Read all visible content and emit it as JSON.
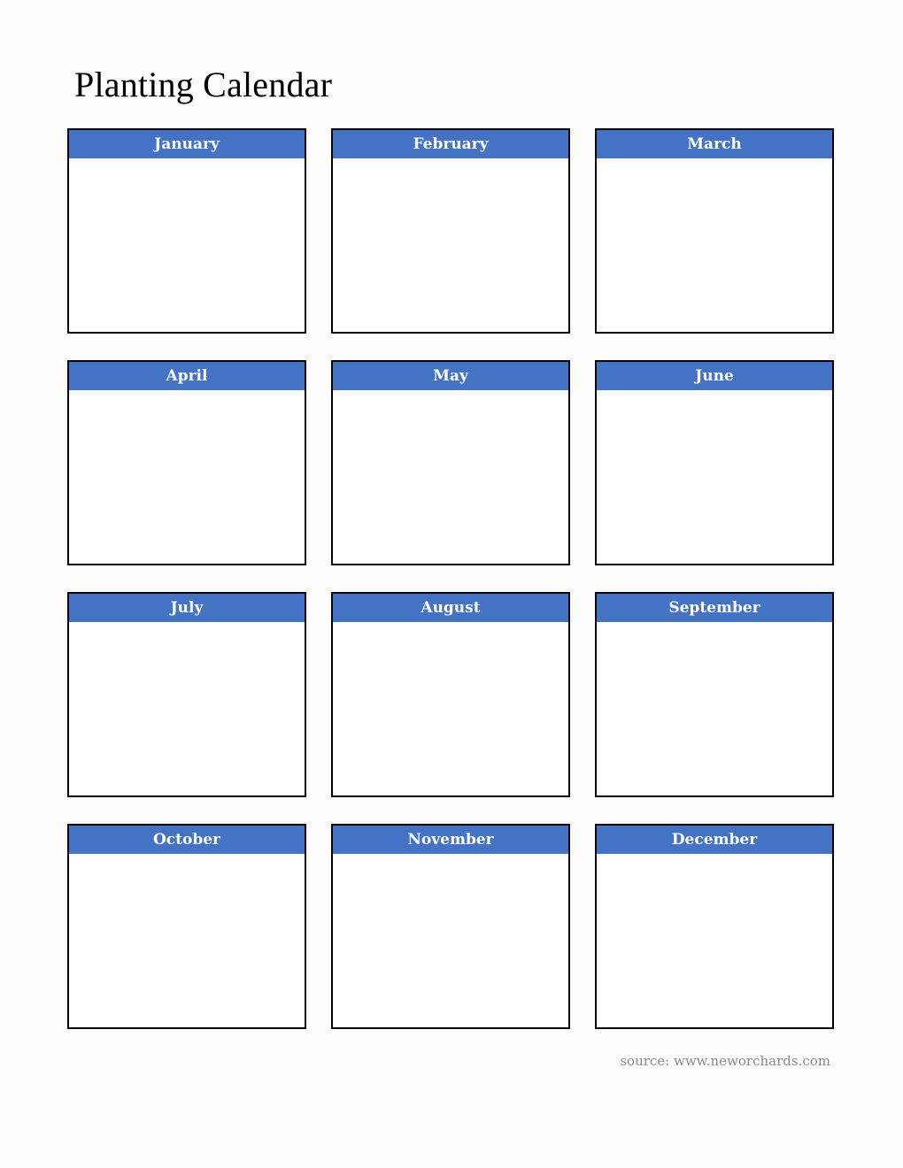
{
  "title": "Planting Calendar",
  "months": [
    {
      "label": "January"
    },
    {
      "label": "February"
    },
    {
      "label": "March"
    },
    {
      "label": "April"
    },
    {
      "label": "May"
    },
    {
      "label": "June"
    },
    {
      "label": "July"
    },
    {
      "label": "August"
    },
    {
      "label": "September"
    },
    {
      "label": "October"
    },
    {
      "label": "November"
    },
    {
      "label": "December"
    }
  ],
  "source": "source: www.neworchards.com",
  "colors": {
    "header_bg": "#4472c4",
    "header_text": "#ffffff",
    "border": "#000000"
  }
}
